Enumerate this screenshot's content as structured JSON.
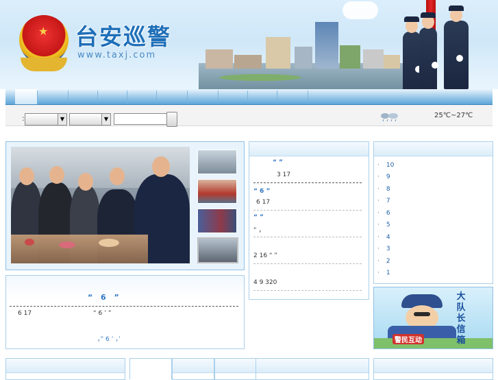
{
  "header": {
    "title": "台安巡警",
    "url": "www.taxj.com"
  },
  "search": {
    "colon": ":",
    "select1": "",
    "select2": "",
    "keyword": "",
    "button": ""
  },
  "weather": {
    "icon": "cloud-rain-icon",
    "temperature": "25℃~27℃"
  },
  "featured_news": {
    "headline": "“ 6 ”",
    "line1": "6 17",
    "line2": "“ 6 ’    ”",
    "line3": "，” 6 ’     ，’"
  },
  "middle_news": [
    {
      "title": "“   ”",
      "detail": "3 17"
    },
    {
      "title": "“ 6 ”",
      "detail": "6 17"
    },
    {
      "title": "“   ”",
      "detail": "“ ，"
    },
    {
      "title": "",
      "detail": "2 16        “   ”"
    },
    {
      "title": "",
      "detail": "4 9  320"
    }
  ],
  "right_list": [
    "10",
    "9",
    "8",
    "7",
    "6",
    "5",
    "4",
    "3",
    "2",
    "1"
  ],
  "right_list_bullet": "·",
  "mailbox": {
    "title": "大队长信箱",
    "subtitle": "警民互动"
  },
  "colors": {
    "accent": "#2e74c2",
    "nav": "#5ea6d9",
    "border": "#a9cfea"
  }
}
